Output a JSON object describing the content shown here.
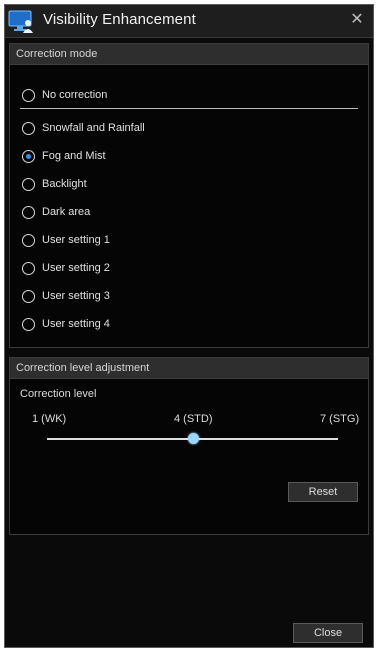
{
  "window": {
    "title": "Visibility Enhancement",
    "close_glyph": "✕"
  },
  "correction_mode": {
    "header": "Correction mode",
    "selected": "Fog and Mist",
    "options": [
      "No correction",
      "Snowfall and Rainfall",
      "Fog and Mist",
      "Backlight",
      "Dark area",
      "User setting 1",
      "User setting 2",
      "User setting 3",
      "User setting 4"
    ]
  },
  "correction_level": {
    "header": "Correction level adjustment",
    "label": "Correction level",
    "min_label": "1 (WK)",
    "mid_label": "4 (STD)",
    "max_label": "7 (STG)",
    "min": 1,
    "max": 7,
    "value": 4,
    "reset_label": "Reset"
  },
  "footer": {
    "close_label": "Close"
  },
  "colors": {
    "accent": "#3f8fe8",
    "slider_thumb": "#9ad6ff",
    "background": "#0a0a0a"
  },
  "icons": {
    "app": "monitor-person-icon",
    "close": "close-icon"
  }
}
